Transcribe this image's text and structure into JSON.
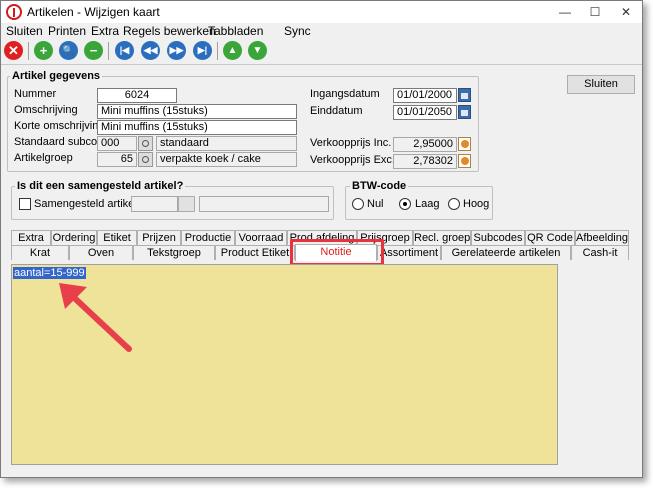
{
  "window": {
    "title": "Artikelen - Wijzigen kaart"
  },
  "titlebar_buttons": [
    "—",
    "☐",
    "✕"
  ],
  "menu": [
    "Sluiten",
    "Printen",
    "Extra",
    "Regels bewerken",
    "Tabbladen",
    "Sync"
  ],
  "toolbar": {
    "delete": "✕",
    "add": "+",
    "search": "🔍",
    "remove": "−",
    "first": "|◀",
    "prev": "◀◀",
    "next": "▶▶",
    "last": "▶|",
    "up": "▲",
    "down": "▼"
  },
  "artikel": {
    "title": "Artikel gegevens",
    "nummer_label": "Nummer",
    "nummer": "6024",
    "omschrijving_label": "Omschrijving",
    "omschrijving": "Mini muffins (15stuks)",
    "korte_label": "Korte omschrijving",
    "korte": "Mini muffins (15stuks)",
    "subcode_label": "Standaard subcode",
    "subcode": "000",
    "subcode_name": "standaard",
    "groep_label": "Artikelgroep",
    "groep": "65",
    "groep_name": "verpakte koek / cake",
    "ingangsdatum_label": "Ingangsdatum",
    "ingangsdatum": "01/01/2000",
    "einddatum_label": "Einddatum",
    "einddatum": "01/01/2050",
    "vp_inc_label": "Verkoopprijs Inc.",
    "vp_inc": "2,95000",
    "vp_exc_label": "Verkoopprijs Exc.",
    "vp_exc": "2,78302"
  },
  "close_button": "Sluiten",
  "samengesteld": {
    "title": "Is dit een samengesteld artikel?",
    "checkbox_label": "Samengesteld artikel"
  },
  "btw": {
    "title": "BTW-code",
    "options": [
      "Nul",
      "Laag",
      "Hoog"
    ],
    "selected": "Laag"
  },
  "tabs_row1": [
    "Extra",
    "Ordering",
    "Etiket",
    "Prijzen",
    "Productie",
    "Voorraad",
    "Prod afdeling",
    "Prijsgroep",
    "Recl. groep",
    "Subcodes",
    "QR Code",
    "Afbeelding"
  ],
  "tabs_row2": [
    "Krat",
    "Oven",
    "Tekstgroep",
    "Product Etiket",
    "Notitie",
    "Assortiment",
    "Gerelateerde artikelen",
    "Cash-it"
  ],
  "active_tab": "Notitie",
  "notitie": {
    "text": "aantal=15-999"
  },
  "colors": {
    "highlight": "#e8323c",
    "notes_bg": "#efe39a",
    "active_tab": "#e02020"
  }
}
